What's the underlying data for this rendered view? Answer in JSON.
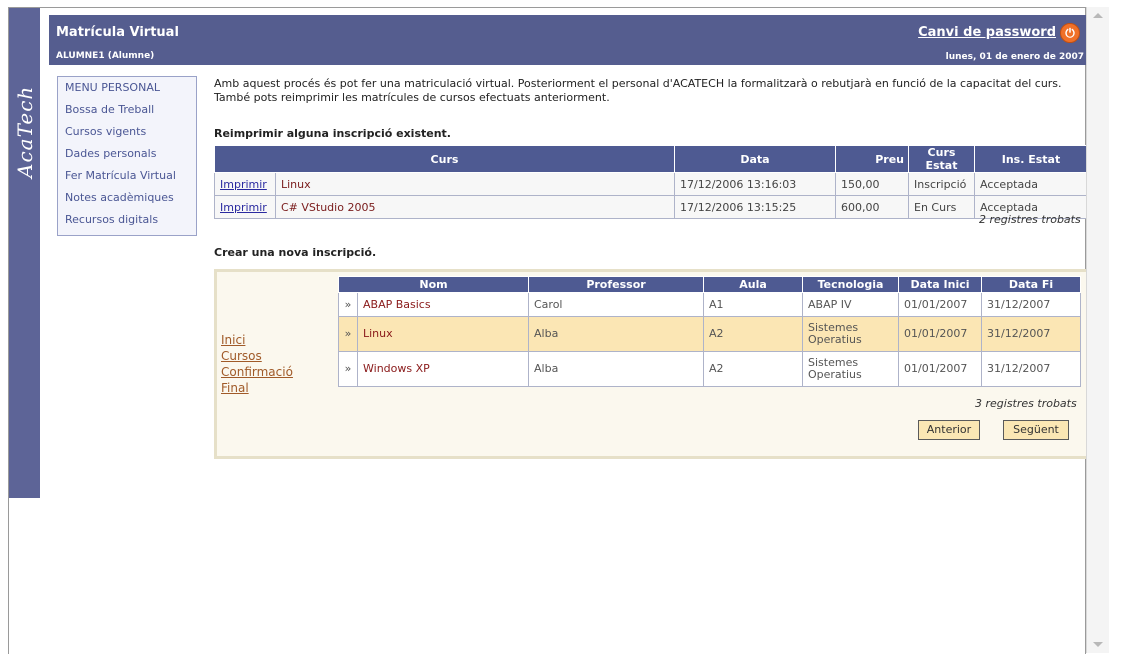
{
  "sidebar": {
    "logo": "AcaTech"
  },
  "header": {
    "title": "Matrícula Virtual",
    "user": "ALUMNE1 (Alumne)",
    "password_link": "Canvi de password",
    "date": "lunes, 01 de enero de 2007"
  },
  "menu": {
    "items": [
      {
        "label": "MENU PERSONAL"
      },
      {
        "label": "Bossa de Treball"
      },
      {
        "label": "Cursos vigents"
      },
      {
        "label": "Dades personals"
      },
      {
        "label": "Fer Matrícula Virtual"
      },
      {
        "label": "Notes acadèmiques"
      },
      {
        "label": "Recursos digitals"
      }
    ]
  },
  "intro": "Amb aquest procés és pot fer una matriculació virtual. Posteriorment el personal d'ACATECH la formalitzarà o rebutjarà en funció de la capacitat del curs. També pots reimprimir les matrícules de cursos efectuats anteriorment.",
  "reprint": {
    "heading": "Reimprimir alguna inscripció existent.",
    "headers": [
      "Curs",
      "Data",
      "Preu",
      "Curs Estat",
      "Ins. Estat"
    ],
    "rows": [
      {
        "action": "Imprimir",
        "curs": "Linux",
        "data": "17/12/2006 13:16:03",
        "preu": "150,00",
        "curs_estat": "Inscripció",
        "ins_estat": "Acceptada"
      },
      {
        "action": "Imprimir",
        "curs": "C# VStudio 2005",
        "data": "17/12/2006 13:15:25",
        "preu": "600,00",
        "curs_estat": "En Curs",
        "ins_estat": "Acceptada"
      }
    ],
    "count": "2 registres trobats"
  },
  "create": {
    "heading": "Crear una nova inscripció.",
    "steps": [
      "Inici",
      "Cursos",
      "Confirmació",
      "Final"
    ],
    "headers": [
      "Nom",
      "Professor",
      "Aula",
      "Tecnologia",
      "Data Inici",
      "Data Fi"
    ],
    "rows": [
      {
        "arrow": "»",
        "nom": "ABAP Basics",
        "professor": "Carol",
        "aula": "A1",
        "tecnologia": "ABAP IV",
        "inici": "01/01/2007",
        "fi": "31/12/2007"
      },
      {
        "arrow": "»",
        "nom": "Linux",
        "professor": "Alba",
        "aula": "A2",
        "tecnologia": "Sistemes Operatius",
        "inici": "01/01/2007",
        "fi": "31/12/2007"
      },
      {
        "arrow": "»",
        "nom": "Windows XP",
        "professor": "Alba",
        "aula": "A2",
        "tecnologia": "Sistemes Operatius",
        "inici": "01/01/2007",
        "fi": "31/12/2007"
      }
    ],
    "count": "3 registres trobats",
    "prev_label": "Anterior",
    "next_label": "Següent"
  }
}
